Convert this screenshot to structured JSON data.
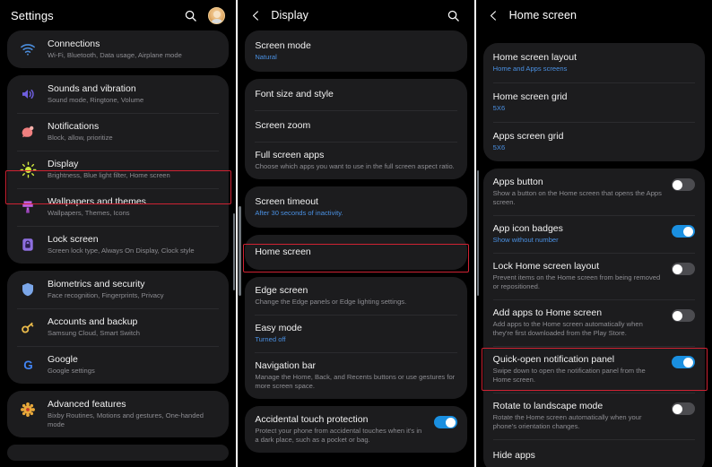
{
  "panels": {
    "settings": {
      "title": "Settings",
      "search_icon": "search-icon",
      "avatar_label": "profile-avatar",
      "groups": [
        {
          "rows": [
            {
              "icon": "wifi-icon",
              "title": "Connections",
              "sub": "Wi-Fi, Bluetooth, Data usage, Airplane mode"
            }
          ]
        },
        {
          "rows": [
            {
              "icon": "speaker-icon",
              "title": "Sounds and vibration",
              "sub": "Sound mode, Ringtone, Volume"
            },
            {
              "icon": "notification-icon",
              "title": "Notifications",
              "sub": "Block, allow, prioritize"
            },
            {
              "icon": "brightness-icon",
              "title": "Display",
              "sub": "Brightness, Blue light filter, Home screen"
            },
            {
              "icon": "wallpaper-brush-icon",
              "title": "Wallpapers and themes",
              "sub": "Wallpapers, Themes, Icons"
            },
            {
              "icon": "lock-icon",
              "title": "Lock screen",
              "sub": "Screen lock type, Always On Display, Clock style"
            }
          ]
        },
        {
          "rows": [
            {
              "icon": "shield-icon",
              "title": "Biometrics and security",
              "sub": "Face recognition, Fingerprints, Privacy"
            },
            {
              "icon": "key-icon",
              "title": "Accounts and backup",
              "sub": "Samsung Cloud, Smart Switch"
            },
            {
              "icon": "google-g-icon",
              "title": "Google",
              "sub": "Google settings"
            }
          ]
        },
        {
          "rows": [
            {
              "icon": "gear-flower-icon",
              "title": "Advanced features",
              "sub": "Bixby Routines, Motions and gestures, One-handed mode"
            }
          ]
        }
      ]
    },
    "display": {
      "title": "Display",
      "back_icon": "back-chevron-icon",
      "search_icon": "search-icon",
      "groups": [
        {
          "rows": [
            {
              "title": "Screen mode",
              "sub": "Natural",
              "sub_style": "blue"
            }
          ]
        },
        {
          "rows": [
            {
              "title": "Font size and style",
              "sub": ""
            },
            {
              "title": "Screen zoom",
              "sub": ""
            },
            {
              "title": "Full screen apps",
              "sub": "Choose which apps you want to use in the full screen aspect ratio."
            }
          ]
        },
        {
          "rows": [
            {
              "title": "Screen timeout",
              "sub": "After 30 seconds of inactivity.",
              "sub_style": "blue"
            }
          ]
        },
        {
          "rows": [
            {
              "title": "Home screen",
              "sub": ""
            }
          ]
        },
        {
          "rows": [
            {
              "title": "Edge screen",
              "sub": "Change the Edge panels or Edge lighting settings."
            },
            {
              "title": "Easy mode",
              "sub": "Turned off",
              "sub_style": "blue"
            },
            {
              "title": "Navigation bar",
              "sub": "Manage the Home, Back, and Recents buttons or use gestures for more screen space."
            }
          ]
        },
        {
          "rows": [
            {
              "title": "Accidental touch protection",
              "sub": "Protect your phone from accidental touches when it's in a dark place, such as a pocket or bag.",
              "toggle": "on"
            }
          ]
        }
      ]
    },
    "home_screen": {
      "title": "Home screen",
      "back_icon": "back-chevron-icon",
      "groups": [
        {
          "rows": [
            {
              "title": "Home screen layout",
              "sub": "Home and Apps screens",
              "sub_style": "blue"
            },
            {
              "title": "Home screen grid",
              "sub": "5X6",
              "sub_style": "blue"
            },
            {
              "title": "Apps screen grid",
              "sub": "5X6",
              "sub_style": "blue"
            }
          ]
        },
        {
          "rows": [
            {
              "title": "Apps button",
              "sub": "Show a button on the Home screen that opens the Apps screen.",
              "toggle": "off"
            },
            {
              "title": "App icon badges",
              "sub": "Show without number",
              "sub_style": "blue",
              "toggle": "on"
            },
            {
              "title": "Lock Home screen layout",
              "sub": "Prevent items on the Home screen from being removed or repositioned.",
              "toggle": "off"
            },
            {
              "title": "Add apps to Home screen",
              "sub": "Add apps to the Home screen automatically when they're first downloaded from the Play Store.",
              "toggle": "off"
            },
            {
              "title": "Quick-open notification panel",
              "sub": "Swipe down to open the notification panel from the Home screen.",
              "toggle": "on"
            },
            {
              "title": "Rotate to landscape mode",
              "sub": "Rotate the Home screen automatically when your phone's orientation changes.",
              "toggle": "off"
            },
            {
              "title": "Hide apps",
              "sub": ""
            }
          ]
        }
      ]
    }
  },
  "highlights": {
    "display_row": "Display",
    "home_screen_row": "Home screen",
    "quick_open_row": "Quick-open notification panel"
  },
  "colors": {
    "highlight": "#cf2233",
    "accent_blue": "#4a90e2",
    "toggle_on": "#1a8fe0",
    "card_bg": "#1c1c1e",
    "page_bg": "#000000"
  }
}
